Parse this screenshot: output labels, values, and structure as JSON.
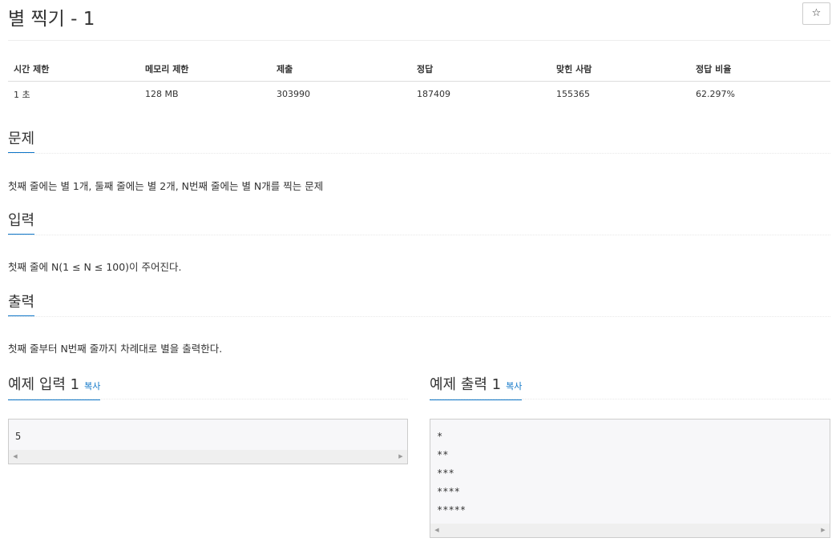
{
  "problem": {
    "title": "별 찍기 - 1",
    "star_icon": "☆"
  },
  "info_table": {
    "headers": [
      "시간 제한",
      "메모리 제한",
      "제출",
      "정답",
      "맞힌 사람",
      "정답 비율"
    ],
    "values": [
      "1 초",
      "128 MB",
      "303990",
      "187409",
      "155365",
      "62.297%"
    ]
  },
  "sections": {
    "description": {
      "title": "문제",
      "text": "첫째 줄에는 별 1개, 둘째 줄에는 별 2개, N번째 줄에는 별 N개를 찍는 문제"
    },
    "input": {
      "title": "입력",
      "text": "첫째 줄에 N(1 ≤ N ≤ 100)이 주어진다."
    },
    "output": {
      "title": "출력",
      "text": "첫째 줄부터 N번째 줄까지 차례대로 별을 출력한다."
    }
  },
  "samples": {
    "input": {
      "title": "예제 입력 1",
      "copy_label": "복사",
      "content": "5"
    },
    "output": {
      "title": "예제 출력 1",
      "copy_label": "복사",
      "content": "*\n**\n***\n****\n*****"
    },
    "scroll_left": "◀",
    "scroll_right": "▶"
  }
}
